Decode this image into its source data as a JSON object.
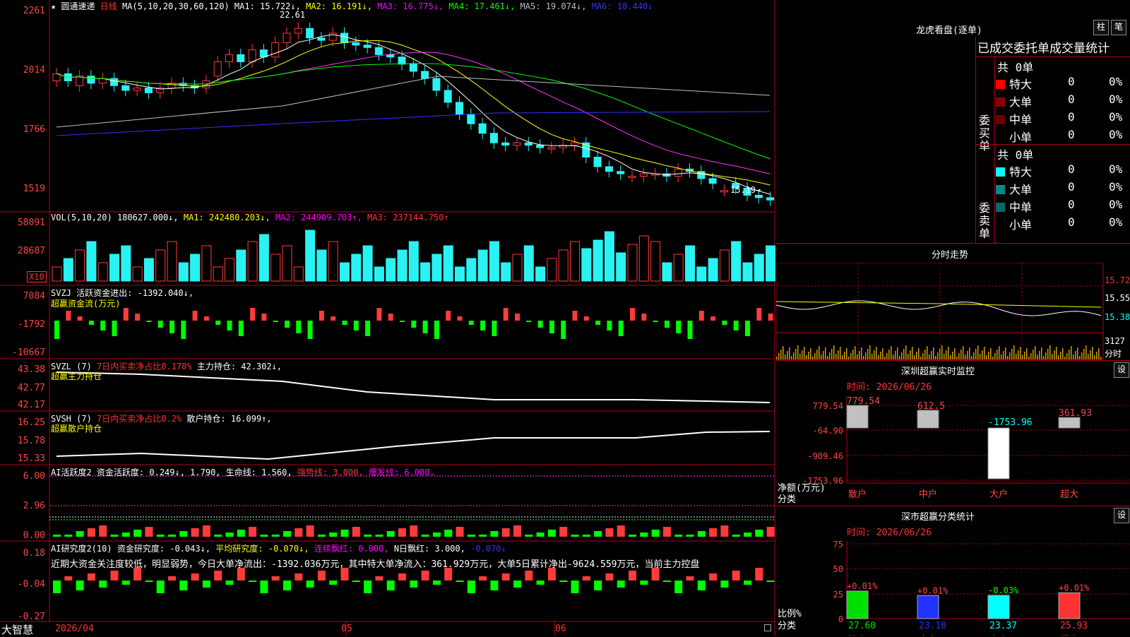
{
  "colors": {
    "up": "#ff3b3b",
    "down": "#2af2f2",
    "grid": "#b0001a",
    "bg": "#000000",
    "ma1": "#ffffff",
    "ma2": "#ffff00",
    "ma3": "#ff33ff",
    "ma4": "#00ff00",
    "ma5": "#c0c0c0",
    "ma6": "#3333ff"
  },
  "kline": {
    "star": "★",
    "stock": "圆通速递",
    "period": "日线",
    "ma_header": "MA(5,10,20,30,60,120)",
    "ma1": "MA1: 15.722↓,",
    "ma2": "MA2: 16.191↓,",
    "ma3": "MA3: 16.775↓,",
    "ma4": "MA4: 17.461↓,",
    "ma5": "MA5: 19.074↓,",
    "ma6": "MA6: 18.440↓",
    "high_label": "22.61",
    "low_label": "15.19→",
    "yaxis": [
      "2261",
      "2014",
      "1766",
      "1519"
    ]
  },
  "vol": {
    "header": "VOL(5,10,20)",
    "value": "180627.000↓,",
    "ma1": "MA1: 242480.203↓,",
    "ma2": "MA2: 244909.703↑,",
    "ma3": "MA3: 237144.750↑",
    "yaxis": [
      "58091",
      "28687"
    ],
    "unit": "X10"
  },
  "svzj": {
    "title": "SVZJ",
    "label": "活跃资金进出:",
    "value": "-1392.040↓,",
    "sub": "超赢资金流(万元)",
    "yaxis": [
      "7084",
      "-1792",
      "-10667"
    ]
  },
  "svzl": {
    "title": "SVZL (7)",
    "label1": "7日内买卖净占比0.178%",
    "label2": "主力持仓: 42.302↓,",
    "sub": "超赢主力持仓",
    "yaxis": [
      "43.38",
      "42.77",
      "42.17"
    ]
  },
  "svsh": {
    "title": "SVSH (7)",
    "label1": "7日内买卖净占比0.2%",
    "label2": "散户持仓: 16.099↑,",
    "sub": "超赢散户持仓",
    "yaxis": [
      "16.25",
      "15.78",
      "15.33"
    ]
  },
  "ai1": {
    "title": "AI活跃度2",
    "label": "资金活跃度: 0.249↓, 1.790,",
    "life": "生命线: 1.560,",
    "strong": "强势线: 3.000,",
    "burst": "爆发线: 6.000,",
    "yaxis": [
      "6.00",
      "2.96",
      "0.00"
    ]
  },
  "ai2": {
    "title": "AI研究度2(10)",
    "label": "资金研究度: -0.043↓,",
    "avg": "平均研究度: -0.070↓,",
    "red": "连续飘红: 0.000,",
    "nred": "N日飘红: 3.000,",
    "last": "-0.070↓",
    "comment": "近期大资金关注度较低，明显弱势，今日大单净流出：-1392.036万元，其中特大单净流入：361.929万元，大单5日累计净出-9624.559万元，当前主力控盘",
    "yaxis": [
      "0.18",
      "-0.04",
      "-0.27"
    ]
  },
  "bottom": {
    "brand": "大智慧",
    "dates": [
      "2026/04",
      "05",
      "06"
    ]
  },
  "lhb": {
    "title": "龙虎看盘(逐单)",
    "btn1": "柱",
    "btn2": "笔",
    "tabs": "已成交委托单成交量统计",
    "buy": {
      "side": "委买单",
      "total": "共 0单",
      "rows": [
        {
          "name": "特大",
          "count": "0",
          "pct": "0%"
        },
        {
          "name": "大单",
          "count": "0",
          "pct": "0%"
        },
        {
          "name": "中单",
          "count": "0",
          "pct": "0%"
        },
        {
          "name": "小单",
          "count": "0",
          "pct": "0%"
        }
      ]
    },
    "sell": {
      "side": "委卖单",
      "total": "共 0单",
      "rows": [
        {
          "name": "特大",
          "count": "0",
          "pct": "0%"
        },
        {
          "name": "大单",
          "count": "0",
          "pct": "0%"
        },
        {
          "name": "中单",
          "count": "0",
          "pct": "0%"
        },
        {
          "name": "小单",
          "count": "0",
          "pct": "0%"
        }
      ]
    }
  },
  "intraday": {
    "title": "分时走势",
    "yaxis": [
      "15.72",
      "15.55",
      "15.38"
    ],
    "vol": "3127",
    "unit": "分时"
  },
  "monitor": {
    "title": "深圳超赢实时监控",
    "btn": "设",
    "time": "时间: 2026/06/26",
    "yaxis": [
      "779.54",
      "-64.90",
      "-909.46",
      "-1753.96"
    ],
    "ylabel": "净额(万元)",
    "xlabel": "分类",
    "bars": [
      {
        "cat": "散户",
        "value": 779.54,
        "label": "779.54"
      },
      {
        "cat": "中户",
        "value": 612.5,
        "label": "612.5"
      },
      {
        "cat": "大户",
        "value": -1753.96,
        "label": "-1753.96"
      },
      {
        "cat": "超大",
        "value": 361.93,
        "label": "361.93"
      }
    ]
  },
  "classify": {
    "title": "深市超赢分类统计",
    "btn": "设",
    "time": "时间: 2026/06/26",
    "yaxis": [
      "75",
      "50",
      "25",
      "0"
    ],
    "ylabel": "比例%",
    "xlabel": "分类",
    "bars": [
      {
        "cat": "散户",
        "value": 27.6,
        "change": "+0.01%"
      },
      {
        "cat": "中户",
        "value": 23.1,
        "change": "+0.01%"
      },
      {
        "cat": "大户",
        "value": 23.37,
        "change": "-0.03%"
      },
      {
        "cat": "超大",
        "value": 25.93,
        "change": "+0.01%"
      }
    ]
  },
  "chart_data": [
    {
      "type": "candlestick",
      "title": "圆通速递 日线",
      "ylim": [
        15.0,
        23.0
      ],
      "yticks": [
        "2261",
        "2014",
        "1766",
        "1519"
      ],
      "closes": [
        20.5,
        20.2,
        20.4,
        20.1,
        20.3,
        20.0,
        19.8,
        19.9,
        19.7,
        19.9,
        20.1,
        20.0,
        19.9,
        20.2,
        21.0,
        21.3,
        21.0,
        21.5,
        21.2,
        21.8,
        22.2,
        22.4,
        22.0,
        21.9,
        22.2,
        21.8,
        21.7,
        21.6,
        21.3,
        21.2,
        20.9,
        20.6,
        20.3,
        19.8,
        19.3,
        18.8,
        18.4,
        18.0,
        17.6,
        17.5,
        17.6,
        17.5,
        17.4,
        17.4,
        17.5,
        17.6,
        17.0,
        16.6,
        16.4,
        16.3,
        16.2,
        16.3,
        16.3,
        16.2,
        16.5,
        16.4,
        16.1,
        15.9,
        15.6,
        15.7,
        15.4,
        15.3,
        15.2
      ],
      "opens": [
        20.2,
        20.5,
        20.0,
        20.4,
        20.1,
        20.3,
        20.0,
        19.8,
        19.9,
        19.7,
        19.9,
        20.1,
        20.0,
        19.9,
        20.4,
        21.0,
        21.3,
        21.0,
        21.5,
        21.2,
        21.8,
        22.2,
        22.4,
        22.0,
        21.9,
        22.2,
        21.8,
        21.7,
        21.6,
        21.3,
        21.2,
        20.9,
        20.6,
        20.3,
        19.8,
        19.3,
        18.8,
        18.4,
        18.0,
        17.6,
        17.5,
        17.6,
        17.5,
        17.4,
        17.4,
        17.5,
        17.6,
        17.0,
        16.6,
        16.4,
        16.2,
        16.2,
        16.3,
        16.3,
        16.2,
        16.5,
        16.4,
        16.1,
        15.6,
        15.9,
        15.7,
        15.4,
        15.3
      ]
    },
    {
      "type": "bar",
      "title": "深圳超赢实时监控",
      "categories": [
        "散户",
        "中户",
        "大户",
        "超大"
      ],
      "values": [
        779.54,
        612.5,
        -1753.96,
        361.93
      ],
      "ylabel": "净额(万元)",
      "ylim": [
        -1753.96,
        779.54
      ]
    },
    {
      "type": "bar",
      "title": "深市超赢分类统计",
      "categories": [
        "散户",
        "中户",
        "大户",
        "超大"
      ],
      "values": [
        27.6,
        23.1,
        23.37,
        25.93
      ],
      "ylabel": "比例%",
      "ylim": [
        0,
        75
      ]
    }
  ]
}
